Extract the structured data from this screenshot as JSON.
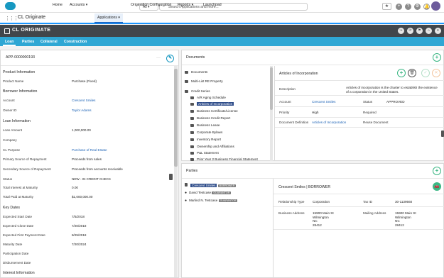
{
  "top": {
    "scope": "All",
    "search_placeholder": "Search Applications and more..."
  },
  "nav": {
    "app": "CL Originate",
    "items": [
      "Home",
      "Accounts",
      "Applications",
      "Origination Configuration",
      "Reports",
      "Launchpad"
    ]
  },
  "header": {
    "logo": "CL ORIGINATE"
  },
  "tabs": [
    "Loan",
    "Parties",
    "Collateral",
    "Construction"
  ],
  "left": {
    "app_id": "APP-0000000193",
    "product_info": {
      "heading": "Product Information",
      "rows": [
        [
          "Product Name",
          "Purchase (Fixed)"
        ]
      ]
    },
    "borrower_info": {
      "heading": "Borrower Information",
      "rows": [
        [
          "Account",
          "Crescent Smiles"
        ],
        [
          "Owner ID",
          "Taylor Adams"
        ]
      ]
    },
    "loan_info": {
      "heading": "Loan Information",
      "rows": [
        [
          "Loan Amount",
          "1,000,000.00"
        ],
        [
          "Company",
          ""
        ],
        [
          "CL Purpose",
          "Purchase of Real Estate"
        ],
        [
          "Primary Source of Repayment",
          "Proceeds from sales"
        ],
        [
          "Secondary Source of Repayment",
          "Proceeds from accounts receivable"
        ],
        [
          "Status",
          "NEW - IN CREDIT CHECK"
        ],
        [
          "Total Interest at Maturity",
          "0.00"
        ],
        [
          "Total Paid at Maturity",
          "$1,000,000.00"
        ]
      ]
    },
    "key_dates": {
      "heading": "Key Dates",
      "rows": [
        [
          "Expected Start Date",
          "7/5/2018"
        ],
        [
          "Expected Close Date",
          "7/20/2018"
        ],
        [
          "Expected First Payment Date",
          "8/25/2018"
        ],
        [
          "Maturity Date",
          "7/20/2024"
        ],
        [
          "Participation Date",
          ""
        ],
        [
          "Disbursement Date",
          ""
        ]
      ]
    },
    "interest_info": {
      "heading": "Interest Information"
    }
  },
  "documents": {
    "title": "Documents",
    "tree": [
      "Documents",
      "Multi-List RE Property",
      "Credit Series",
      "A/R Aging Schedule",
      "Articles of Incorporation",
      "Business Certificate/License",
      "Business Credit Report",
      "Business Lease",
      "Corporate Bylaws",
      "Inventory Report",
      "Ownership and Affiliations",
      "P&L Statement",
      "Prior Year 2 Business Financial Statement"
    ],
    "detail": {
      "title": "Articles of Incorporation",
      "description_label": "Description",
      "description": "Articles of incorporation is the charter to establish the existence of a corporation in the United States.",
      "rows": [
        [
          "Account",
          "Crescent Smiles",
          "Status",
          "APPROVED"
        ],
        [
          "Priority",
          "High",
          "Required",
          ""
        ],
        [
          "Document Definition",
          "Articles of Incorporation",
          "Reuse Document",
          ""
        ]
      ]
    }
  },
  "parties": {
    "title": "Parties",
    "list": [
      {
        "name": "Crescent Smiles",
        "badge": "BORROWER"
      },
      {
        "name": "David Testcase",
        "badge": "GUARANTOR"
      },
      {
        "name": "Marlind N. Testcase",
        "badge": "GUARANTOR"
      }
    ],
    "detail": {
      "title": "Crescent Smiles | BORROWER",
      "rel_label": "Relationship Type",
      "rel": "Corporation",
      "tax_label": "Tax ID",
      "tax": "30-1139560",
      "baddr_label": "Business Address",
      "baddr": [
        "15900 Main St",
        "Wilmington",
        "NC",
        "28412"
      ],
      "maddr_label": "Mailing Address",
      "maddr": [
        "15900 Main St",
        "Wilmington",
        "NC",
        "28412"
      ]
    }
  }
}
